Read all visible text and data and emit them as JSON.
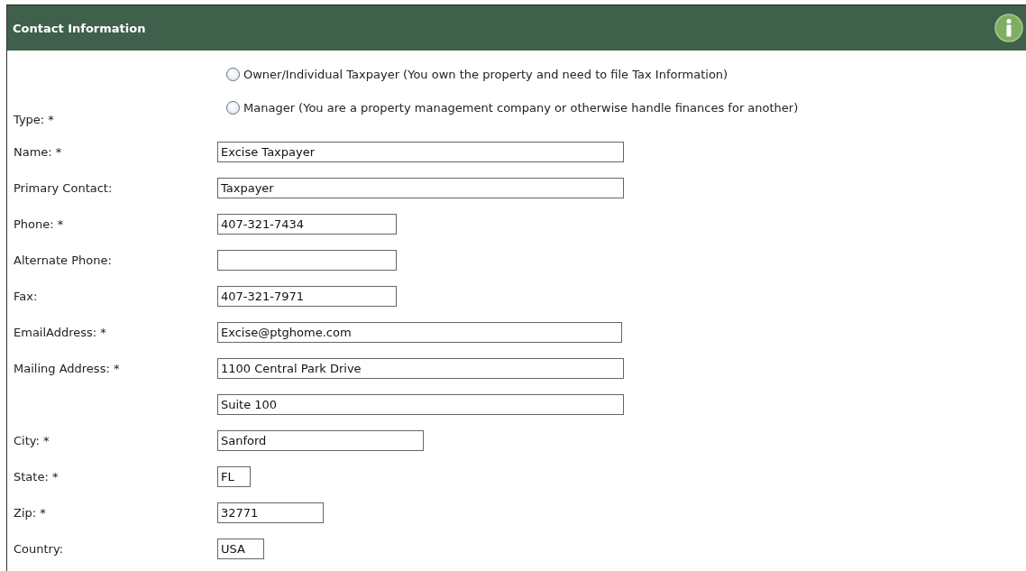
{
  "section": {
    "title": "Contact Information"
  },
  "type_field": {
    "label": "Type: *",
    "options": [
      {
        "label": "Owner/Individual Taxpayer (You own the property and need to file Tax Information)",
        "selected": false
      },
      {
        "label": "Manager (You are a property management company or otherwise handle finances for another)",
        "selected": false
      }
    ]
  },
  "fields": [
    {
      "label": "Name: *",
      "value": "Excise Taxpayer"
    },
    {
      "label": "Primary Contact:",
      "value": "Taxpayer"
    },
    {
      "label": "Phone: *",
      "value": "407-321-7434"
    },
    {
      "label": "Alternate Phone:"
    },
    {
      "label": "Fax:",
      "value": "407-321-7971"
    },
    {
      "label": "EmailAddress: *",
      "value": "Excise@ptghome.com"
    },
    {
      "label": "Mailing Address: *",
      "value": "1100 Central Park Drive"
    },
    {
      "value": "Suite 100"
    },
    {
      "label": "City: *",
      "value": "Sanford"
    },
    {
      "label": "State: *",
      "value": "FL"
    },
    {
      "label": "Zip: *",
      "value": "32771"
    },
    {
      "label": "Country:",
      "value": "USA"
    }
  ]
}
